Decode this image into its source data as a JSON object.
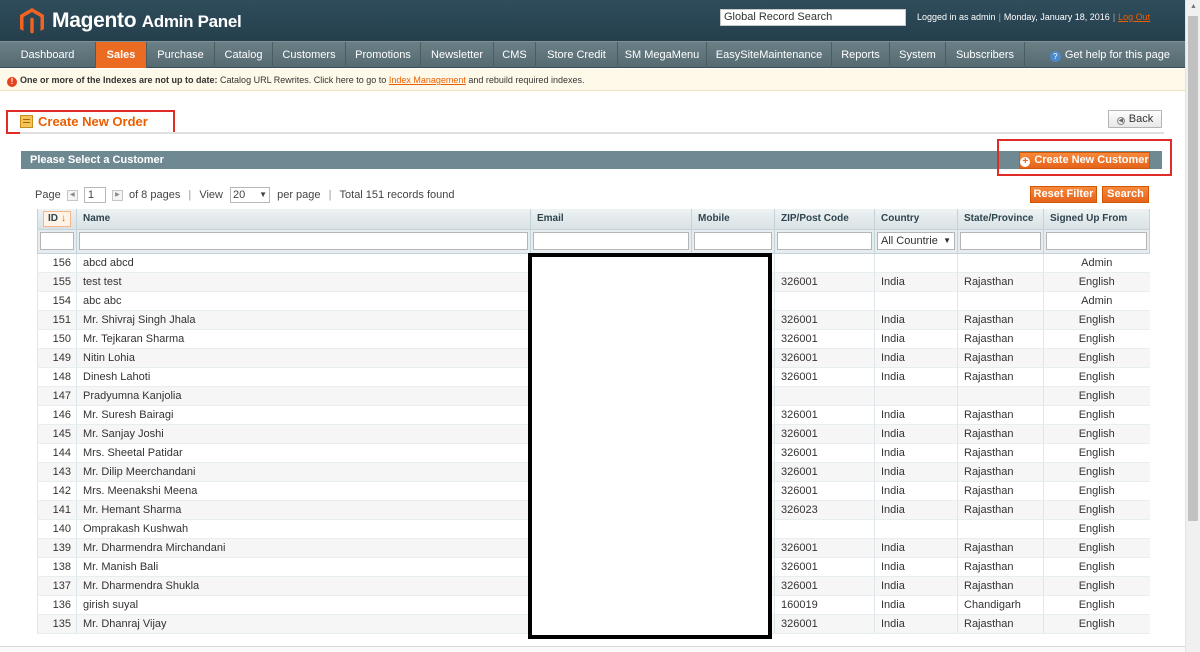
{
  "header": {
    "brand_main": "Magento",
    "brand_sub": "Admin Panel",
    "global_search_placeholder": "Global Record Search",
    "logged_in": "Logged in as admin",
    "date": "Monday, January 18, 2016",
    "logout": "Log Out"
  },
  "nav": {
    "items": [
      "Dashboard",
      "Sales",
      "Purchase",
      "Catalog",
      "Customers",
      "Promotions",
      "Newsletter",
      "CMS",
      "Store Credit",
      "SM MegaMenu",
      "EasySiteMaintenance",
      "Reports",
      "System",
      "Subscribers"
    ],
    "active": "Sales",
    "help": "Get help for this page"
  },
  "notice": {
    "strong": "One or more of the Indexes are not up to date:",
    "text": "Catalog URL Rewrites. Click here to go to",
    "link": "Index Management",
    "after": "and rebuild required indexes."
  },
  "page": {
    "title": "Create New Order",
    "back": "Back"
  },
  "section": {
    "title": "Please Select a Customer",
    "create_customer": "Create New Customer"
  },
  "pager": {
    "page_label": "Page",
    "page": "1",
    "of_pages": "of 8 pages",
    "view_label": "View",
    "per_page": "20",
    "per_page_label": "per page",
    "total": "Total 151 records found",
    "reset_filter": "Reset Filter",
    "search": "Search"
  },
  "grid": {
    "columns": [
      "ID",
      "Name",
      "Email",
      "Mobile",
      "ZIP/Post Code",
      "Country",
      "State/Province",
      "Signed Up From"
    ],
    "country_filter": "All Countrie",
    "rows": [
      {
        "id": "156",
        "name": "abcd abcd",
        "zip": "",
        "country": "",
        "state": "",
        "from": "Admin"
      },
      {
        "id": "155",
        "name": "test test",
        "zip": "326001",
        "country": "India",
        "state": "Rajasthan",
        "from": "English"
      },
      {
        "id": "154",
        "name": "abc abc",
        "zip": "",
        "country": "",
        "state": "",
        "from": "Admin"
      },
      {
        "id": "151",
        "name": "Mr. Shivraj Singh Jhala",
        "zip": "326001",
        "country": "India",
        "state": "Rajasthan",
        "from": "English"
      },
      {
        "id": "150",
        "name": "Mr. Tejkaran Sharma",
        "zip": "326001",
        "country": "India",
        "state": "Rajasthan",
        "from": "English"
      },
      {
        "id": "149",
        "name": "Nitin Lohia",
        "zip": "326001",
        "country": "India",
        "state": "Rajasthan",
        "from": "English"
      },
      {
        "id": "148",
        "name": "Dinesh Lahoti",
        "zip": "326001",
        "country": "India",
        "state": "Rajasthan",
        "from": "English"
      },
      {
        "id": "147",
        "name": "Pradyumna Kanjolia",
        "zip": "",
        "country": "",
        "state": "",
        "from": "English"
      },
      {
        "id": "146",
        "name": "Mr. Suresh Bairagi",
        "zip": "326001",
        "country": "India",
        "state": "Rajasthan",
        "from": "English"
      },
      {
        "id": "145",
        "name": "Mr. Sanjay Joshi",
        "zip": "326001",
        "country": "India",
        "state": "Rajasthan",
        "from": "English"
      },
      {
        "id": "144",
        "name": "Mrs. Sheetal Patidar",
        "zip": "326001",
        "country": "India",
        "state": "Rajasthan",
        "from": "English"
      },
      {
        "id": "143",
        "name": "Mr. Dilip Meerchandani",
        "zip": "326001",
        "country": "India",
        "state": "Rajasthan",
        "from": "English"
      },
      {
        "id": "142",
        "name": "Mrs. Meenakshi Meena",
        "zip": "326001",
        "country": "India",
        "state": "Rajasthan",
        "from": "English"
      },
      {
        "id": "141",
        "name": "Mr. Hemant Sharma",
        "zip": "326023",
        "country": "India",
        "state": "Rajasthan",
        "from": "English"
      },
      {
        "id": "140",
        "name": "Omprakash Kushwah",
        "zip": "",
        "country": "",
        "state": "",
        "from": "English"
      },
      {
        "id": "139",
        "name": "Mr. Dharmendra Mirchandani",
        "zip": "326001",
        "country": "India",
        "state": "Rajasthan",
        "from": "English"
      },
      {
        "id": "138",
        "name": "Mr. Manish Bali",
        "zip": "326001",
        "country": "India",
        "state": "Rajasthan",
        "from": "English"
      },
      {
        "id": "137",
        "name": "Mr. Dharmendra Shukla",
        "zip": "326001",
        "country": "India",
        "state": "Rajasthan",
        "from": "English"
      },
      {
        "id": "136",
        "name": "girish suyal",
        "zip": "160019",
        "country": "India",
        "state": "Chandigarh",
        "from": "English"
      },
      {
        "id": "135",
        "name": "Mr. Dhanraj Vijay",
        "zip": "326001",
        "country": "India",
        "state": "Rajasthan",
        "from": "English"
      }
    ]
  },
  "colors": {
    "accent": "#eb5e00",
    "header_bg": "#2f4d5c",
    "section_head": "#6f8992",
    "highlight_box": "#e02b27"
  }
}
